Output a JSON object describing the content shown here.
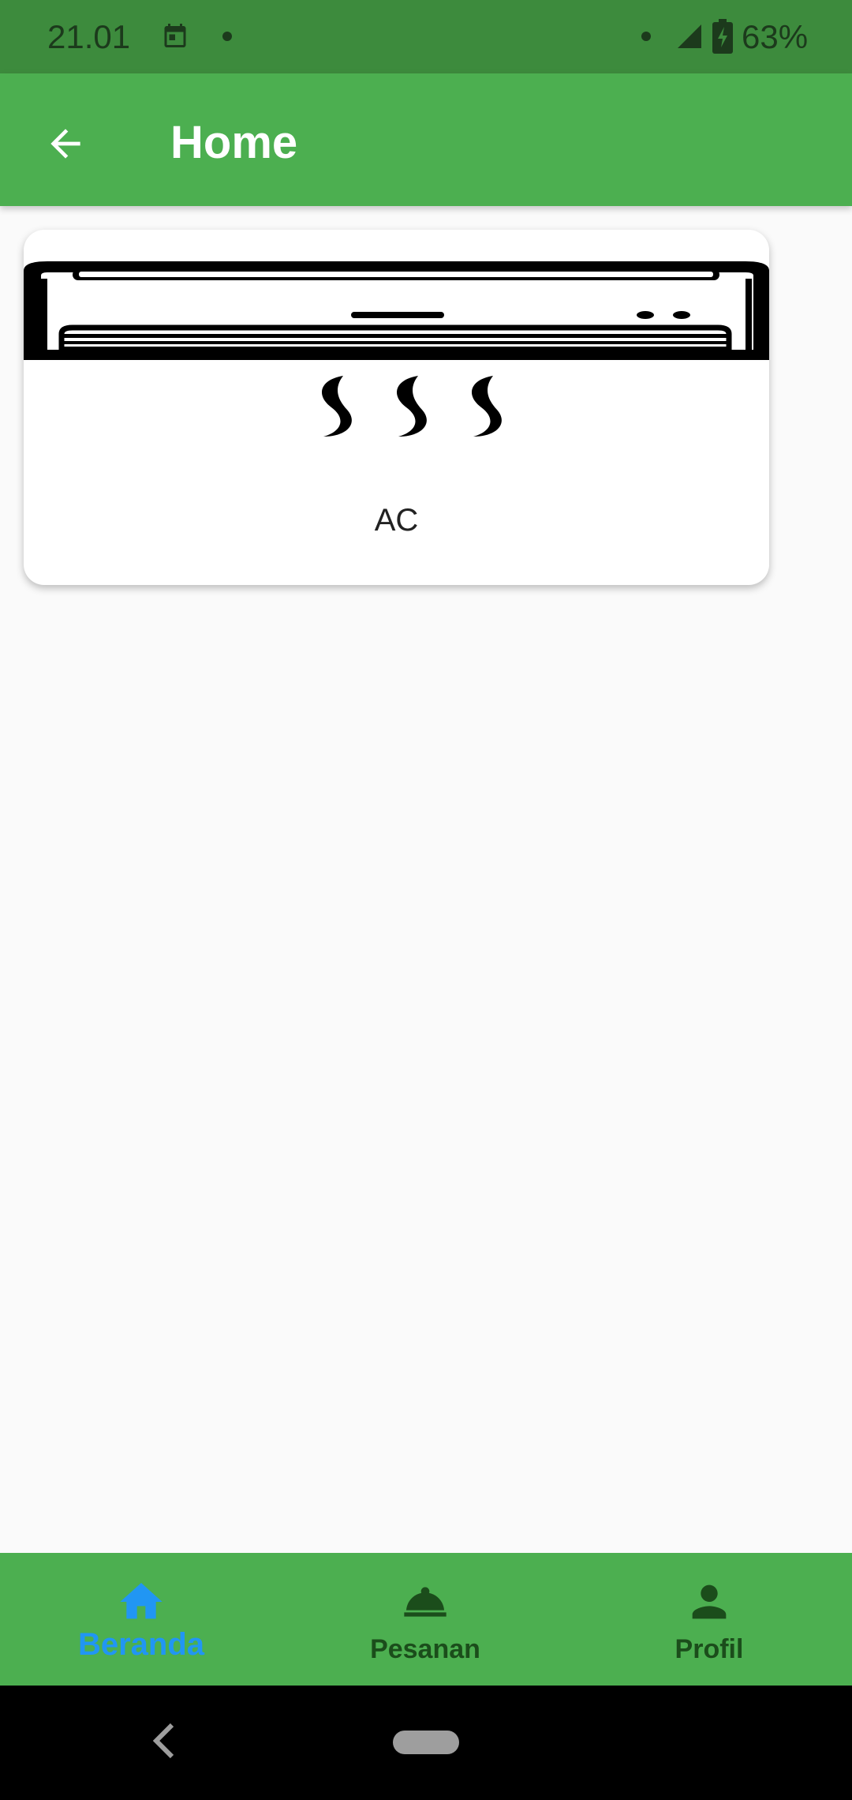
{
  "status_bar": {
    "time": "21.01",
    "battery": "63%",
    "icons": [
      "calendar-icon",
      "notification-dot",
      "signal-icon",
      "battery-charging-icon"
    ]
  },
  "app_bar": {
    "title": "Home",
    "back_icon": "arrow-back-icon"
  },
  "services": [
    {
      "label": "AC",
      "icon": "air-conditioner-image"
    }
  ],
  "bottom_nav": {
    "items": [
      {
        "label": "Beranda",
        "icon": "home-icon",
        "active": true
      },
      {
        "label": "Pesanan",
        "icon": "room-service-bell-icon",
        "active": false
      },
      {
        "label": "Profil",
        "icon": "person-icon",
        "active": false
      }
    ]
  },
  "colors": {
    "status_bar": "#3d8b3d",
    "primary": "#4caf50",
    "active_nav": "#2196f3",
    "inactive_nav": "#1b4d1b",
    "background": "#fafafa"
  }
}
